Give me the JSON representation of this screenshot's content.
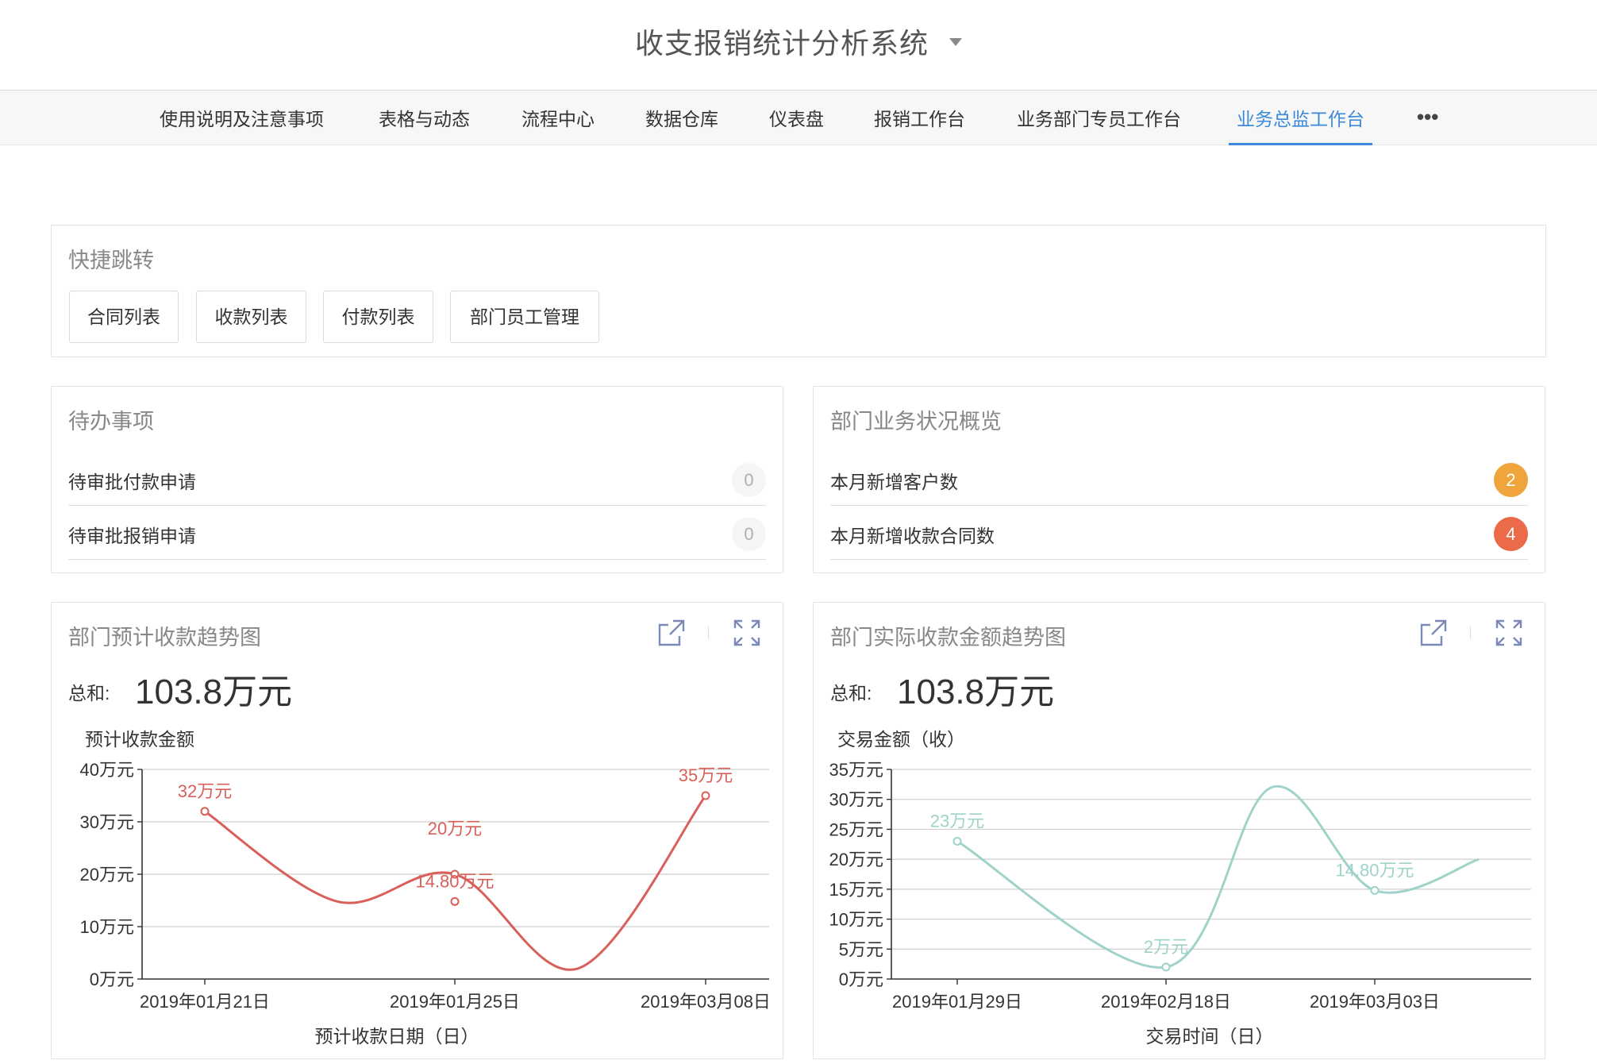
{
  "header": {
    "title": "收支报销统计分析系统"
  },
  "nav": {
    "items": [
      {
        "label": "使用说明及注意事项"
      },
      {
        "label": "表格与动态"
      },
      {
        "label": "流程中心"
      },
      {
        "label": "数据仓库"
      },
      {
        "label": "仪表盘"
      },
      {
        "label": "报销工作台"
      },
      {
        "label": "业务部门专员工作台"
      },
      {
        "label": "业务总监工作台",
        "active": true
      }
    ],
    "more": "•••",
    "active_color": "#3b8ad9"
  },
  "quick": {
    "title": "快捷跳转",
    "buttons": [
      "合同列表",
      "收款列表",
      "付款列表",
      "部门员工管理"
    ]
  },
  "todo": {
    "title": "待办事项",
    "rows": [
      {
        "label": "待审批付款申请",
        "count": "0"
      },
      {
        "label": "待审批报销申请",
        "count": "0"
      }
    ]
  },
  "overview": {
    "title": "部门业务状况概览",
    "rows": [
      {
        "label": "本月新增客户数",
        "count": "2",
        "color": "#f0a53c"
      },
      {
        "label": "本月新增收款合同数",
        "count": "4",
        "color": "#eb6a4a"
      }
    ]
  },
  "chart_panels": {
    "left": {
      "title": "部门预计收款趋势图",
      "sum_label": "总和:",
      "sum_value": "103.8万元"
    },
    "right": {
      "title": "部门实际收款金额趋势图",
      "sum_label": "总和:",
      "sum_value": "103.8万元"
    }
  },
  "icons": {
    "open": "external-link-icon",
    "expand": "fullscreen-icon"
  },
  "chart_data": [
    {
      "type": "line",
      "ylabel": "预计收款金额",
      "xlabel": "预计收款日期（日）",
      "yunit": "万元",
      "ylim": [
        0,
        40
      ],
      "yticks": [
        0,
        10,
        20,
        30,
        40
      ],
      "categories": [
        "2019年01月21日",
        "2019年01月25日",
        "2019年03月08日"
      ],
      "color": "#d9605a",
      "grid": true,
      "series": [
        {
          "values": [
            32,
            20,
            35
          ],
          "labels": [
            "32万元",
            "20万元",
            "35万元"
          ]
        }
      ],
      "annotations": [
        {
          "x": "2019年01月25日",
          "value": 14.8,
          "label": "14.80万元"
        }
      ]
    },
    {
      "type": "line",
      "ylabel": "交易金额（收）",
      "xlabel": "交易时间（日）",
      "yunit": "万元",
      "ylim": [
        0,
        35
      ],
      "yticks": [
        0,
        5,
        10,
        15,
        20,
        25,
        30,
        35
      ],
      "categories": [
        "2019年01月29日",
        "2019年02月18日",
        "2019年03月03日"
      ],
      "color": "#9fd3c9",
      "grid": true,
      "series": [
        {
          "values": [
            23,
            2,
            14.8
          ],
          "labels": [
            "23万元",
            "2万元",
            "14.80万元"
          ]
        }
      ]
    }
  ]
}
